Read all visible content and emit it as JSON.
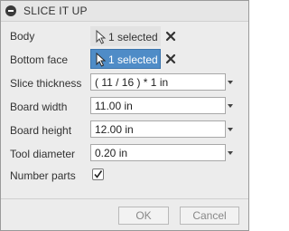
{
  "title": "SLICE IT UP",
  "rows": {
    "body": {
      "label": "Body",
      "value": "1 selected"
    },
    "bottom_face": {
      "label": "Bottom face",
      "value": "1 selected"
    },
    "slice_thickness": {
      "label": "Slice thickness",
      "value": "( 11 / 16 ) * 1 in"
    },
    "board_width": {
      "label": "Board width",
      "value": "11.00 in"
    },
    "board_height": {
      "label": "Board height",
      "value": "12.00 in"
    },
    "tool_diameter": {
      "label": "Tool diameter",
      "value": "0.20 in"
    },
    "number_parts": {
      "label": "Number parts",
      "checked": true
    }
  },
  "buttons": {
    "ok": "OK",
    "cancel": "Cancel"
  },
  "colors": {
    "active_selection": "#4f8cc7",
    "dialog_bg": "#ececec"
  },
  "icons": [
    "minus-circle-icon",
    "cursor-arrow-icon",
    "clear-x-icon",
    "dropdown-arrow-icon",
    "checkmark-icon"
  ]
}
